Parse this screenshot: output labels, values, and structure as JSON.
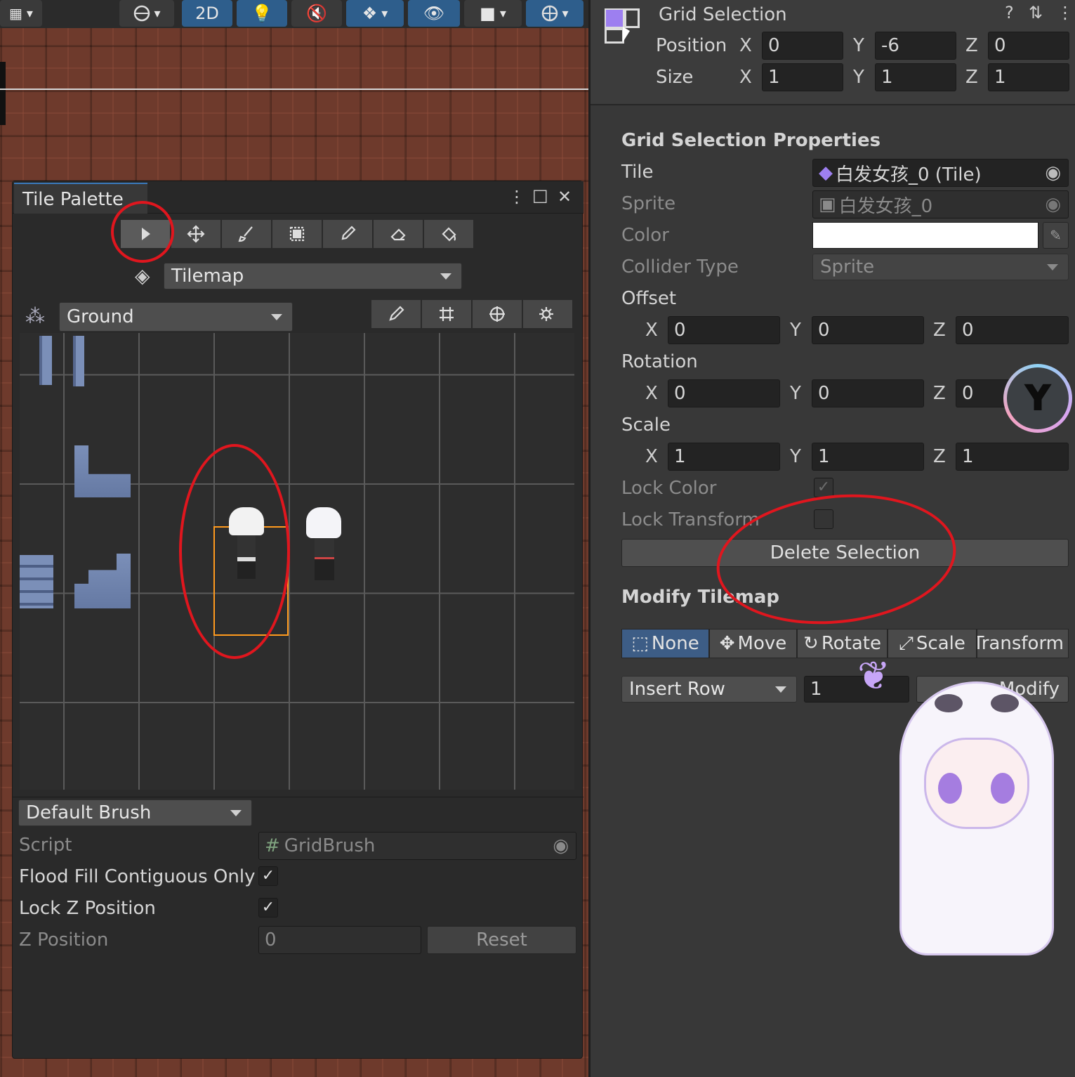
{
  "scene_toolbar": {
    "mode_2d": "2D"
  },
  "palette": {
    "title": "Tile Palette",
    "active_tilemap": "Tilemap",
    "palette_name": "Ground",
    "brush": "Default Brush",
    "script_label": "Script",
    "script_value": "GridBrush",
    "flood_fill_label": "Flood Fill Contiguous Only",
    "flood_fill_checked": true,
    "lock_z_label": "Lock Z Position",
    "lock_z_checked": true,
    "z_position_label": "Z Position",
    "z_position_value": "0",
    "reset_label": "Reset"
  },
  "inspector": {
    "title": "Grid Selection",
    "position_label": "Position",
    "size_label": "Size",
    "axis_x": "X",
    "axis_y": "Y",
    "axis_z": "Z",
    "position": {
      "x": "0",
      "y": "-6",
      "z": "0"
    },
    "size": {
      "x": "1",
      "y": "1",
      "z": "1"
    },
    "properties_title": "Grid Selection Properties",
    "tile_label": "Tile",
    "tile_value": "白发女孩_0 (Tile)",
    "sprite_label": "Sprite",
    "sprite_value": "白发女孩_0",
    "color_label": "Color",
    "color_value": "#ffffff",
    "collider_label": "Collider Type",
    "collider_value": "Sprite",
    "offset_label": "Offset",
    "offset": {
      "x": "0",
      "y": "0",
      "z": "0"
    },
    "rotation_label": "Rotation",
    "rotation": {
      "x": "0",
      "y": "0",
      "z": "0"
    },
    "scale_label": "Scale",
    "scale": {
      "x": "1",
      "y": "1",
      "z": "1"
    },
    "lock_color_label": "Lock Color",
    "lock_color_checked": true,
    "lock_transform_label": "Lock Transform",
    "lock_transform_checked": false,
    "delete_selection_label": "Delete Selection",
    "modify_title": "Modify Tilemap",
    "modify_modes": [
      "None",
      "Move",
      "Rotate",
      "Scale",
      "Transform"
    ],
    "modify_active": "None",
    "insert_mode": "Insert Row",
    "insert_count": "1",
    "modify_button": "Modify"
  },
  "colors": {
    "accent": "#3a79bb",
    "annotation": "#e0161e",
    "selection": "#ff9a1e"
  }
}
